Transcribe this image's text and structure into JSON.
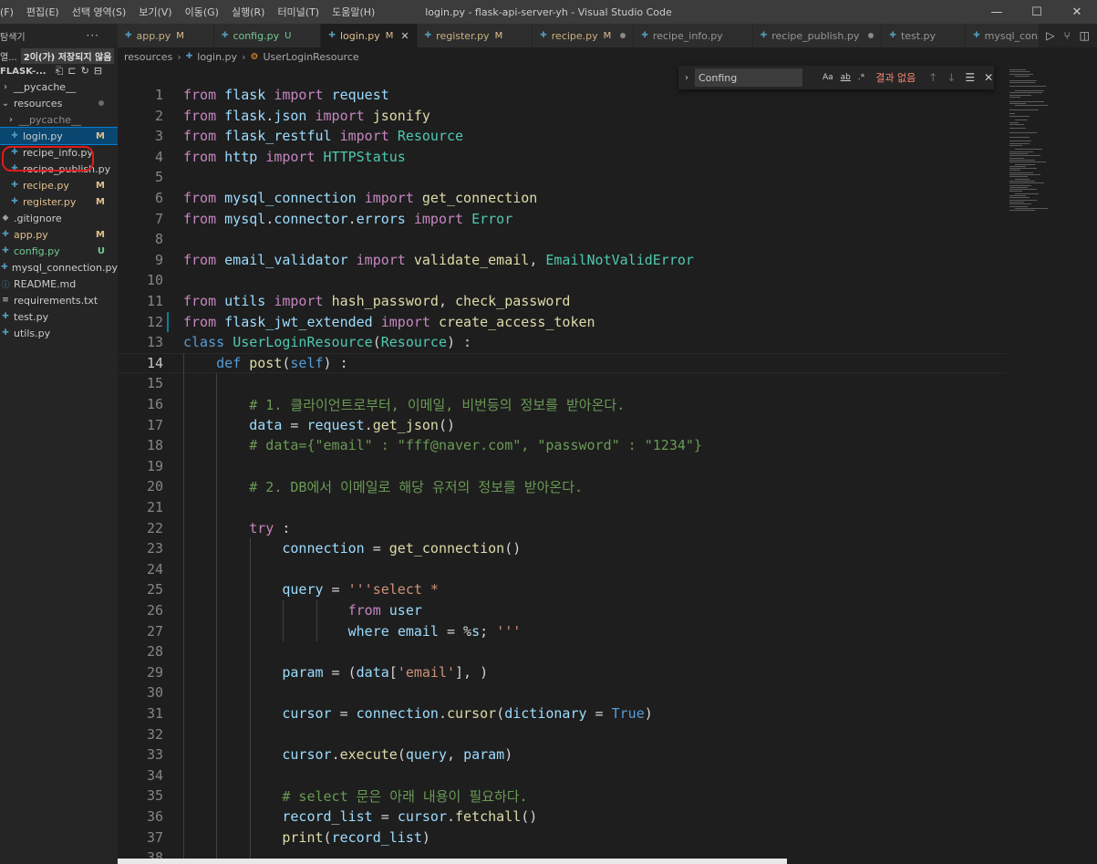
{
  "window": {
    "title": "login.py - flask-api-server-yh - Visual Studio Code",
    "menu": [
      "(F)",
      "편집(E)",
      "선택 영역(S)",
      "보기(V)",
      "이동(G)",
      "실행(R)",
      "터미널(T)",
      "도움말(H)"
    ],
    "controls": {
      "minimize": "—",
      "maximize": "☐",
      "close": "✕"
    }
  },
  "sidebar": {
    "header": "탐색기",
    "more": "···",
    "open_editors_label": "열...",
    "unsaved_badge": "2이(가) 저장되지 않음",
    "project": "FLASK-...",
    "items": [
      {
        "name": "__pycache__",
        "type": "folder",
        "open": false,
        "indent": 0
      },
      {
        "name": "resources",
        "type": "folder",
        "open": true,
        "indent": 0,
        "status": "dot"
      },
      {
        "name": "__pycache__",
        "type": "folder",
        "open": false,
        "indent": 1
      },
      {
        "name": "login.py",
        "type": "py",
        "indent": 1,
        "status": "M",
        "selected": true
      },
      {
        "name": "recipe_info.py",
        "type": "py",
        "indent": 1
      },
      {
        "name": "recipe_publish.py",
        "type": "py",
        "indent": 1
      },
      {
        "name": "recipe.py",
        "type": "py",
        "indent": 1,
        "status": "M"
      },
      {
        "name": "register.py",
        "type": "py",
        "indent": 1,
        "status": "M"
      },
      {
        "name": ".gitignore",
        "type": "git",
        "indent": 0
      },
      {
        "name": "app.py",
        "type": "py",
        "indent": 0,
        "status": "M"
      },
      {
        "name": "config.py",
        "type": "py",
        "indent": 0,
        "status": "U"
      },
      {
        "name": "mysql_connection.py",
        "type": "py",
        "indent": 0
      },
      {
        "name": "README.md",
        "type": "md",
        "indent": 0
      },
      {
        "name": "requirements.txt",
        "type": "txt",
        "indent": 0
      },
      {
        "name": "test.py",
        "type": "py",
        "indent": 0
      },
      {
        "name": "utils.py",
        "type": "py",
        "indent": 0
      }
    ]
  },
  "tabs": [
    {
      "label": "app.py",
      "status": "M"
    },
    {
      "label": "config.py",
      "status": "U"
    },
    {
      "label": "login.py",
      "status": "M",
      "active": true
    },
    {
      "label": "register.py",
      "status": "M"
    },
    {
      "label": "recipe.py",
      "status": "M",
      "dirty": true
    },
    {
      "label": "recipe_info.py"
    },
    {
      "label": "recipe_publish.py",
      "dirty": true
    },
    {
      "label": "test.py"
    },
    {
      "label": "mysql_connection"
    }
  ],
  "breadcrumb": [
    "resources",
    "login.py",
    "UserLoginResource"
  ],
  "find": {
    "value": "Confing",
    "opt_case": "Aa",
    "opt_word": "ab",
    "opt_regex": ".*",
    "result": "결과 없음"
  },
  "editor": {
    "current_line": 14,
    "lines": [
      {
        "n": 1,
        "t": "from flask import request"
      },
      {
        "n": 2,
        "t": "from flask.json import jsonify"
      },
      {
        "n": 3,
        "t": "from flask_restful import Resource"
      },
      {
        "n": 4,
        "t": "from http import HTTPStatus"
      },
      {
        "n": 5,
        "t": ""
      },
      {
        "n": 6,
        "t": "from mysql_connection import get_connection"
      },
      {
        "n": 7,
        "t": "from mysql.connector.errors import Error"
      },
      {
        "n": 8,
        "t": ""
      },
      {
        "n": 9,
        "t": "from email_validator import validate_email, EmailNotValidError"
      },
      {
        "n": 10,
        "t": ""
      },
      {
        "n": 11,
        "t": "from utils import hash_password, check_password"
      },
      {
        "n": 12,
        "t": "from flask_jwt_extended import create_access_token"
      },
      {
        "n": 13,
        "t": "class UserLoginResource(Resource) :"
      },
      {
        "n": 14,
        "t": "    def post(self) :"
      },
      {
        "n": 15,
        "t": ""
      },
      {
        "n": 16,
        "t": "        # 1. 클라이언트로부터, 이메일, 비번등의 정보를 받아온다."
      },
      {
        "n": 17,
        "t": "        data = request.get_json()"
      },
      {
        "n": 18,
        "t": "        # data={\"email\" : \"fff@naver.com\", \"password\" : \"1234\"}"
      },
      {
        "n": 19,
        "t": ""
      },
      {
        "n": 20,
        "t": "        # 2. DB에서 이메일로 해당 유저의 정보를 받아온다."
      },
      {
        "n": 21,
        "t": ""
      },
      {
        "n": 22,
        "t": "        try :"
      },
      {
        "n": 23,
        "t": "            connection = get_connection()"
      },
      {
        "n": 24,
        "t": ""
      },
      {
        "n": 25,
        "t": "            query = '''select *"
      },
      {
        "n": 26,
        "t": "                    from user"
      },
      {
        "n": 27,
        "t": "                    where email = %s; '''"
      },
      {
        "n": 28,
        "t": ""
      },
      {
        "n": 29,
        "t": "            param = (data['email'], )"
      },
      {
        "n": 30,
        "t": ""
      },
      {
        "n": 31,
        "t": "            cursor = connection.cursor(dictionary = True)"
      },
      {
        "n": 32,
        "t": ""
      },
      {
        "n": 33,
        "t": "            cursor.execute(query, param)"
      },
      {
        "n": 34,
        "t": ""
      },
      {
        "n": 35,
        "t": "            # select 문은 아래 내용이 필요하다."
      },
      {
        "n": 36,
        "t": "            record_list = cursor.fetchall()"
      },
      {
        "n": 37,
        "t": "            print(record_list)"
      },
      {
        "n": 38,
        "t": ""
      }
    ]
  },
  "colors": {
    "keyword": "#c586c0",
    "module": "#4ec9b0",
    "function": "#dcdcaa",
    "variable": "#9cdcfe",
    "string": "#ce9178",
    "comment": "#6a9955",
    "modified": "#e2c08d",
    "untracked": "#73c991",
    "highlight_circle": "#e01b1b"
  }
}
